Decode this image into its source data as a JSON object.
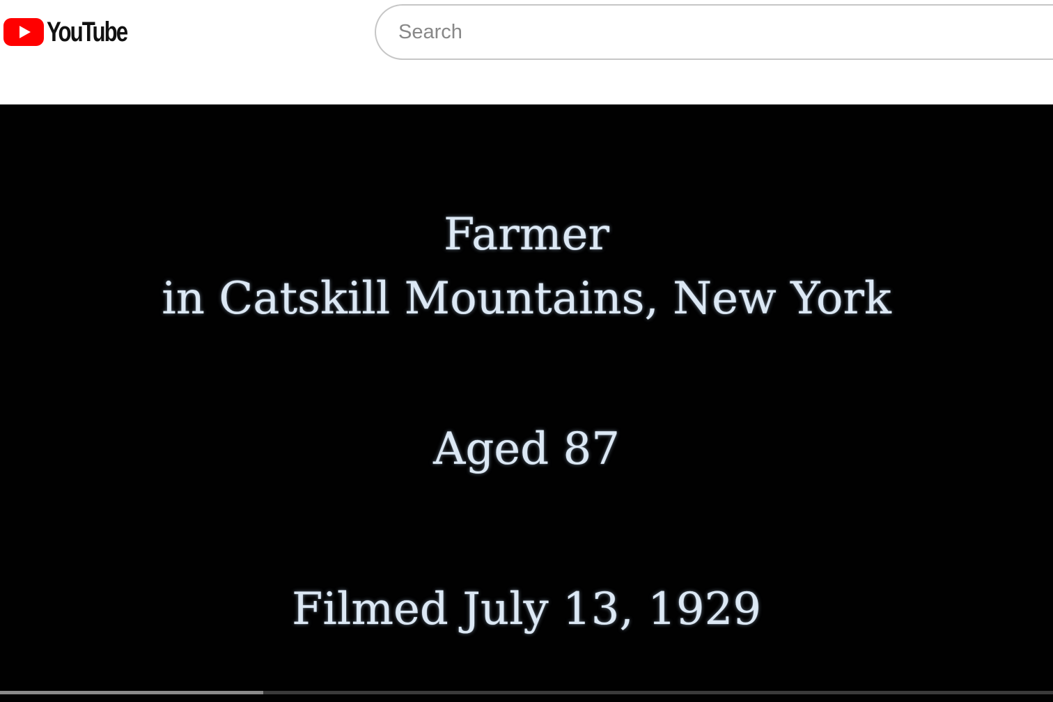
{
  "header": {
    "logo_text": "YouTube",
    "logo_icon": "youtube-play-icon",
    "brand_color": "#ff0000",
    "search": {
      "placeholder": "Search",
      "value": ""
    }
  },
  "video": {
    "caption_lines": [
      "Farmer",
      "in Catskill Mountains, New York",
      "Aged 87",
      "Filmed July 13, 1929"
    ],
    "caption_color": "#dce8f4",
    "background": "#010101",
    "progress_fraction": 0.25
  }
}
